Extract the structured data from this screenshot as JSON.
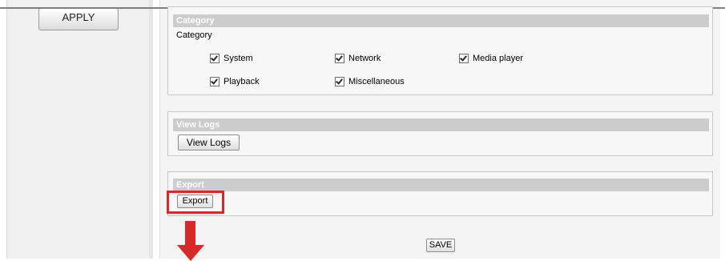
{
  "left_panel": {
    "apply_label": "APPLY"
  },
  "category_section": {
    "header": "Category",
    "label": "Category",
    "checkboxes": [
      {
        "label": "System",
        "checked": true
      },
      {
        "label": "Network",
        "checked": true
      },
      {
        "label": "Media player",
        "checked": true
      },
      {
        "label": "Playback",
        "checked": true
      },
      {
        "label": "Miscellaneous",
        "checked": true
      }
    ]
  },
  "view_logs_section": {
    "header": "View Logs",
    "button_label": "View Logs"
  },
  "export_section": {
    "header": "Export",
    "button_label": "Export"
  },
  "footer": {
    "save_label": "SAVE"
  },
  "annotation": {
    "highlight_color": "#d42a2a"
  }
}
